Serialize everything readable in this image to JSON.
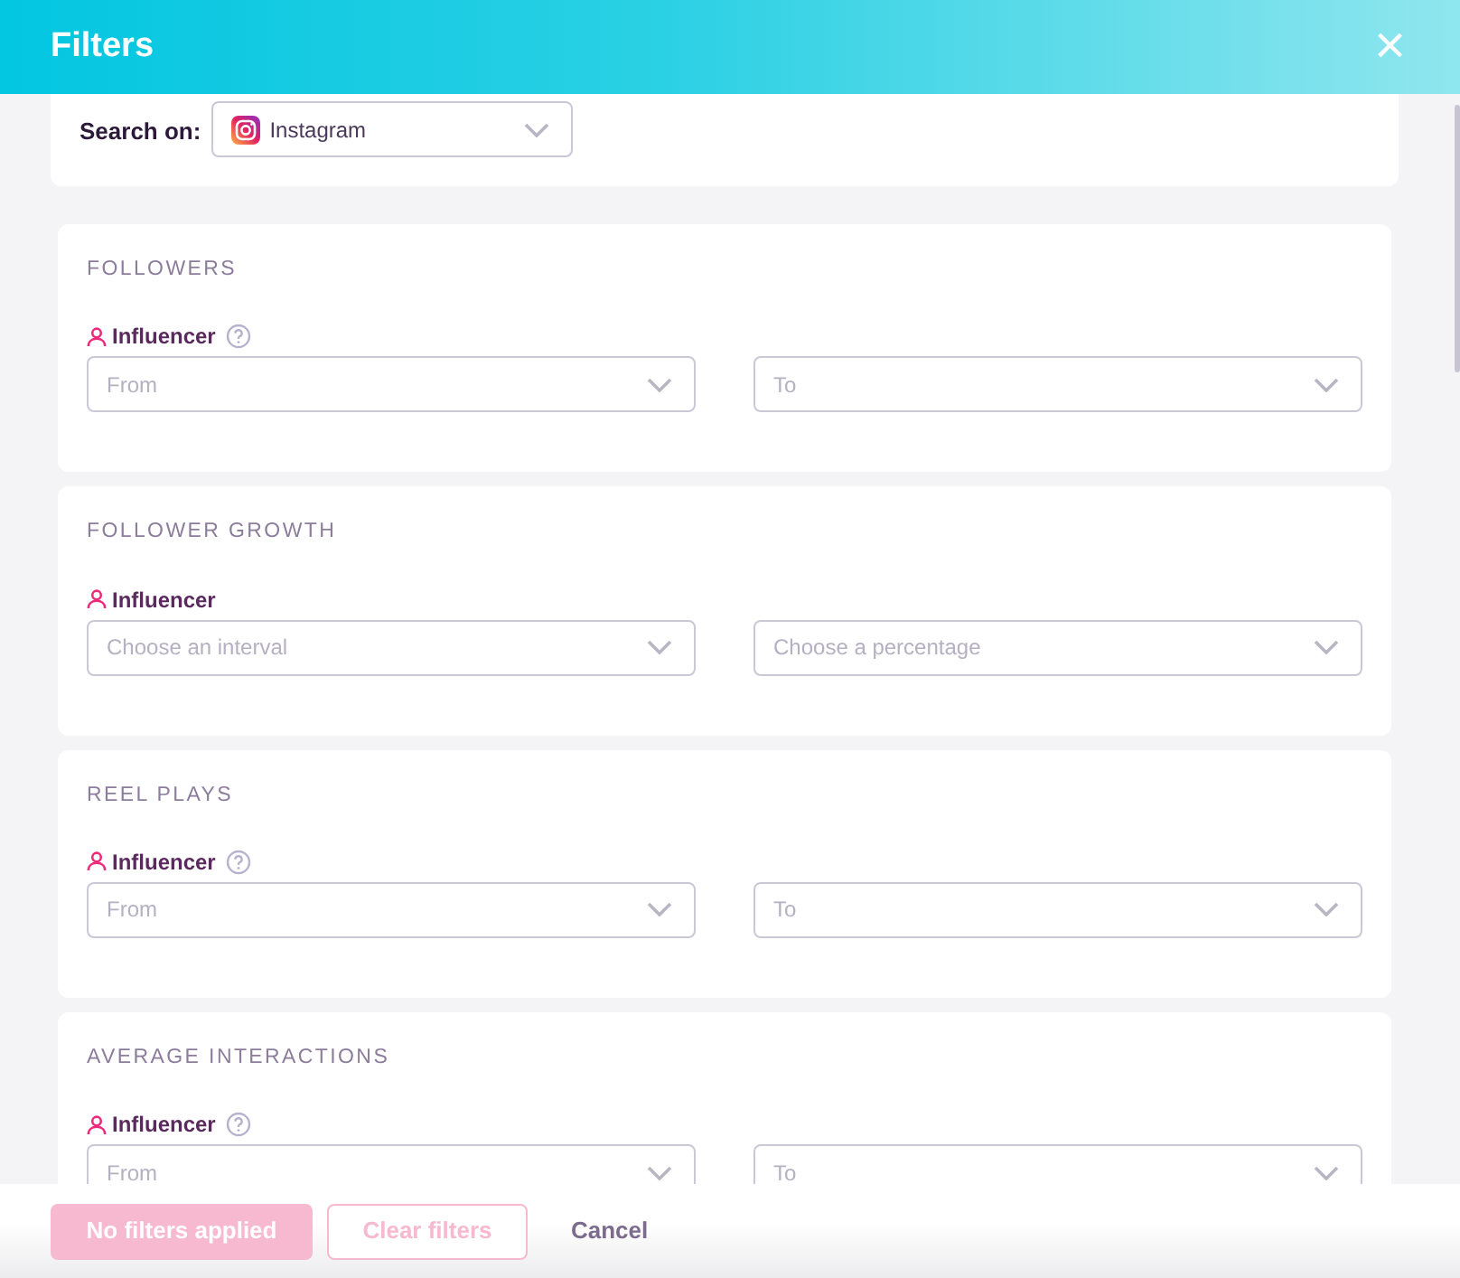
{
  "header": {
    "title": "Filters",
    "close": "×"
  },
  "search": {
    "label": "Search on:",
    "value": "Instagram"
  },
  "sections": [
    {
      "title": "FOLLOWERS",
      "label": "Influencer",
      "help": true,
      "fields": [
        "From",
        "To"
      ]
    },
    {
      "title": "FOLLOWER GROWTH",
      "label": "Influencer",
      "help": false,
      "fields": [
        "Choose an interval",
        "Choose a percentage"
      ]
    },
    {
      "title": "REEL PLAYS",
      "label": "Influencer",
      "help": true,
      "fields": [
        "From",
        "To"
      ]
    },
    {
      "title": "AVERAGE INTERACTIONS",
      "label": "Influencer",
      "help": true,
      "fields": [
        "From",
        "To"
      ]
    }
  ],
  "footer": {
    "apply": {
      "label": "No filters applied",
      "disabled": true
    },
    "clear": {
      "label": "Clear filters",
      "disabled": true
    },
    "cancel": "Cancel"
  }
}
